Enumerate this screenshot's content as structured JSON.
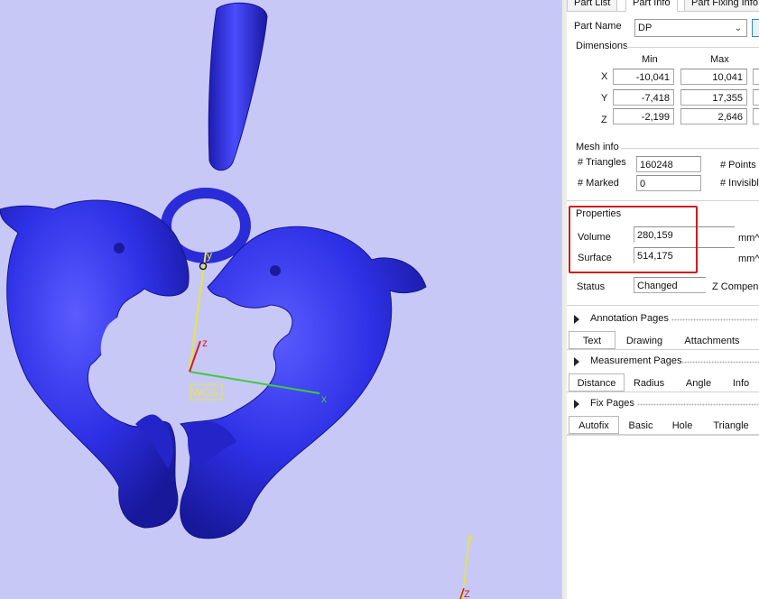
{
  "viewport": {
    "background": "#c8c8f6",
    "model_color": "#2d2ee0",
    "axes": {
      "x": "x",
      "y": "y",
      "z": "z",
      "origin_label": "WCS",
      "corner_y": "Y",
      "corner_z": "Z"
    }
  },
  "tabs": [
    "Part List",
    "Part Info",
    "Part Fixing Info"
  ],
  "part_name": {
    "label": "Part Name",
    "value": "DP"
  },
  "dimensions": {
    "title": "Dimensions",
    "headers": [
      "Min",
      "Max"
    ],
    "rows": [
      {
        "axis": "X",
        "min": "-10,041",
        "max": "10,041"
      },
      {
        "axis": "Y",
        "min": "-7,418",
        "max": "17,355"
      },
      {
        "axis": "Z",
        "min": "-2,199",
        "max": "2,646"
      }
    ]
  },
  "mesh_info": {
    "title": "Mesh info",
    "triangles_label": "# Triangles",
    "triangles_value": "160248",
    "marked_label": "# Marked",
    "marked_value": "0",
    "points_label": "# Points",
    "invisible_label": "# Invisibl"
  },
  "properties": {
    "title": "Properties",
    "volume_label": "Volume",
    "volume_value": "280,159",
    "volume_unit": "mm^",
    "surface_label": "Surface",
    "surface_value": "514,175",
    "surface_unit": "mm^",
    "highlight_color": "#d11c1c"
  },
  "status": {
    "label": "Status",
    "value": "Changed",
    "z_comp_label": "Z Compens"
  },
  "pages": [
    {
      "title": "Annotation Pages",
      "tabs": [
        "Text",
        "Drawing",
        "Attachments"
      ],
      "active": "Text"
    },
    {
      "title": "Measurement Pages",
      "tabs": [
        "Distance",
        "Radius",
        "Angle",
        "Info"
      ],
      "active": "Distance"
    },
    {
      "title": "Fix Pages",
      "tabs": [
        "Autofix",
        "Basic",
        "Hole",
        "Triangle"
      ],
      "active": "Autofix"
    }
  ]
}
